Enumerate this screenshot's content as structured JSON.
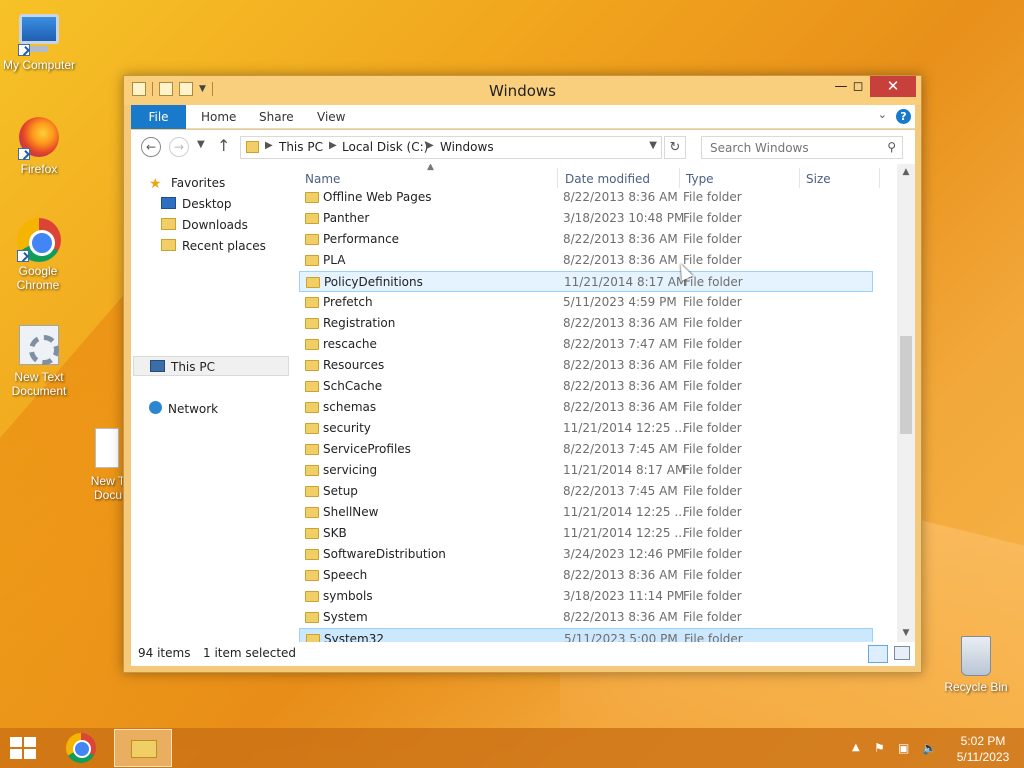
{
  "desktop": {
    "icons": [
      {
        "label": "My Computer"
      },
      {
        "label": "Firefox"
      },
      {
        "label": "Google Chrome"
      },
      {
        "label": "New Text Document"
      },
      {
        "label": "New T Docu"
      },
      {
        "label": "Recycle Bin"
      }
    ]
  },
  "window": {
    "title": "Windows",
    "ribbon_tabs": [
      "File",
      "Home",
      "Share",
      "View"
    ],
    "address": {
      "crumbs": [
        "This PC",
        "Local Disk (C:)",
        "Windows"
      ]
    },
    "search": {
      "placeholder": "Search Windows"
    },
    "nav_pane": {
      "favorites": "Favorites",
      "items": [
        "Desktop",
        "Downloads",
        "Recent places"
      ],
      "this_pc": "This PC",
      "network": "Network"
    },
    "columns": [
      "Name",
      "Date modified",
      "Type",
      "Size"
    ],
    "rows": [
      {
        "name": "Offline Web Pages",
        "date": "8/22/2013 8:36 AM",
        "type": "File folder"
      },
      {
        "name": "Panther",
        "date": "3/18/2023 10:48 PM",
        "type": "File folder"
      },
      {
        "name": "Performance",
        "date": "8/22/2013 8:36 AM",
        "type": "File folder"
      },
      {
        "name": "PLA",
        "date": "8/22/2013 8:36 AM",
        "type": "File folder"
      },
      {
        "name": "PolicyDefinitions",
        "date": "11/21/2014 8:17 AM",
        "type": "File folder"
      },
      {
        "name": "Prefetch",
        "date": "5/11/2023 4:59 PM",
        "type": "File folder"
      },
      {
        "name": "Registration",
        "date": "8/22/2013 8:36 AM",
        "type": "File folder"
      },
      {
        "name": "rescache",
        "date": "8/22/2013 7:47 AM",
        "type": "File folder"
      },
      {
        "name": "Resources",
        "date": "8/22/2013 8:36 AM",
        "type": "File folder"
      },
      {
        "name": "SchCache",
        "date": "8/22/2013 8:36 AM",
        "type": "File folder"
      },
      {
        "name": "schemas",
        "date": "8/22/2013 8:36 AM",
        "type": "File folder"
      },
      {
        "name": "security",
        "date": "11/21/2014 12:25 ...",
        "type": "File folder"
      },
      {
        "name": "ServiceProfiles",
        "date": "8/22/2013 7:45 AM",
        "type": "File folder"
      },
      {
        "name": "servicing",
        "date": "11/21/2014 8:17 AM",
        "type": "File folder"
      },
      {
        "name": "Setup",
        "date": "8/22/2013 7:45 AM",
        "type": "File folder"
      },
      {
        "name": "ShellNew",
        "date": "11/21/2014 12:25 ...",
        "type": "File folder"
      },
      {
        "name": "SKB",
        "date": "11/21/2014 12:25 ...",
        "type": "File folder"
      },
      {
        "name": "SoftwareDistribution",
        "date": "3/24/2023 12:46 PM",
        "type": "File folder"
      },
      {
        "name": "Speech",
        "date": "8/22/2013 8:36 AM",
        "type": "File folder"
      },
      {
        "name": "symbols",
        "date": "3/18/2023 11:14 PM",
        "type": "File folder"
      },
      {
        "name": "System",
        "date": "8/22/2013 8:36 AM",
        "type": "File folder"
      },
      {
        "name": "System32",
        "date": "5/11/2023 5:00 PM",
        "type": "File folder"
      }
    ],
    "status": {
      "count": "94 items",
      "selected": "1 item selected"
    }
  },
  "taskbar": {
    "clock_time": "5:02 PM",
    "clock_date": "5/11/2023"
  },
  "icons": {
    "back": "back-arrow-icon",
    "forward": "forward-arrow-icon",
    "up": "up-arrow-icon",
    "refresh": "refresh-icon",
    "search": "search-icon",
    "help": "help-icon"
  },
  "colors": {
    "accent": "#1979ca",
    "selection": "#cce8ff",
    "close": "#c7403c"
  }
}
